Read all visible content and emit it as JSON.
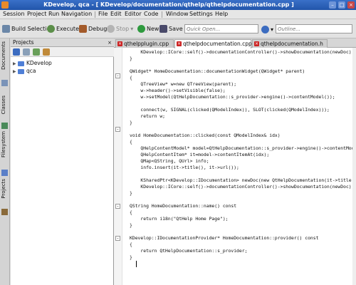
{
  "window": {
    "title": "KDevelop, qca - [ KDevelop/documentation/qthelp/qthelpdocumentation.cpp ]",
    "min": "–",
    "max": "□",
    "close": "×"
  },
  "menu": [
    "Session",
    "Project",
    "Run",
    "Navigation",
    "File",
    "Edit",
    "Editor",
    "Code",
    "Window",
    "Settings",
    "Help"
  ],
  "toolbar": {
    "build_selection": "Build Selection",
    "execute": "Execute",
    "debug": "Debug",
    "stop": "Stop",
    "new": "New",
    "save": "Save",
    "quick_open_placeholder": "Quick Open...",
    "outline_placeholder": "Outline..."
  },
  "sidebar_tabs": [
    "Documents",
    "Classes",
    "Filesystem",
    "Projects"
  ],
  "projects_panel": {
    "title": "Projects",
    "close": "×",
    "items": [
      {
        "label": "KDevelop"
      },
      {
        "label": "qca"
      }
    ]
  },
  "editor": {
    "tabs": [
      {
        "label": "qthelpplugin.cpp",
        "active": false
      },
      {
        "label": "qthelpdocumentation.cpp",
        "active": true
      },
      {
        "label": "qthelpdocumentation.h",
        "active": false
      }
    ],
    "code_lines": [
      "    KDevelop::ICore::self()->documentationController()->showDocumentation(newDoc);",
      "}",
      "",
      "QWidget* HomeDocumentation::documentationWidget(QWidget* parent)",
      "{",
      "    QTreeView* w=new QTreeView(parent);",
      "    w->header()->setVisible(false);",
      "    w->setModel(QtHelpDocumentation::s_provider->engine()->contentModel());",
      "",
      "    connect(w, SIGNAL(clicked(QModelIndex)), SLOT(clicked(QModelIndex)));",
      "    return w;",
      "}",
      "",
      "void HomeDocumentation::clicked(const QModelIndex& idx)",
      "{",
      "    QHelpContentModel* model=QtHelpDocumentation::s_provider->engine()->contentModel();",
      "    QHelpContentItem* it=model->contentItemAt(idx);",
      "    QMap<QString, QUrl> info;",
      "    info.insert(it->title(), it->url());",
      "",
      "    KSharedPtr<KDevelop::IDocumentation> newDoc(new QtHelpDocumentation(it->title(), info));",
      "    KDevelop::ICore::self()->documentationController()->showDocumentation(newDoc);",
      "}",
      "",
      "QString HomeDocumentation::name() const",
      "{",
      "    return i18n(\"QtHelp Home Page\");",
      "}",
      "",
      "KDevelop::IDocumentationProvider* HomeDocumentation::provider() const",
      "{",
      "    return QtHelpDocumentation::s_provider;",
      "}",
      ""
    ]
  },
  "colors": {
    "title_bar": "#2255aa",
    "keyword": "#0000aa",
    "type": "#7a0070",
    "string": "#bb0000",
    "tab_close": "#cc2222"
  }
}
